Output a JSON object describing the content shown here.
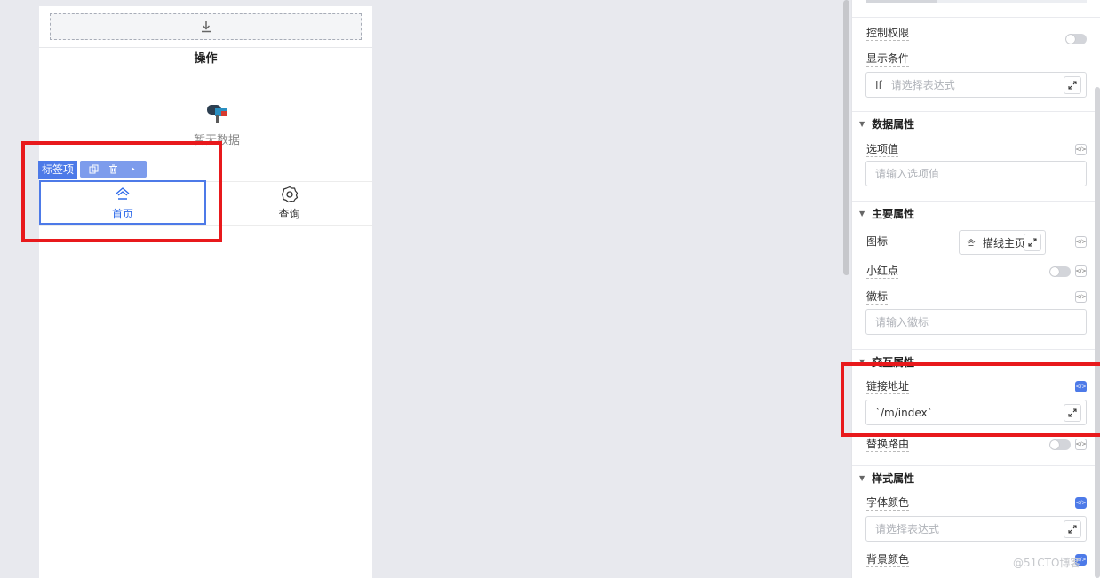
{
  "canvas": {
    "section_title": "操作",
    "empty_text": "暂无数据",
    "tabs": [
      {
        "label": "首页",
        "icon": "home-icon"
      },
      {
        "label": "查询",
        "icon": "gear-icon"
      }
    ],
    "selection": {
      "label": "标签项",
      "actions": [
        "copy-icon",
        "delete-icon",
        "more-arrow-icon"
      ]
    }
  },
  "panel": {
    "control_permission": "控制权限",
    "display_condition": "显示条件",
    "condition_input": {
      "prefix": "If",
      "placeholder": "请选择表达式"
    },
    "data_group": "数据属性",
    "option_value_label": "选项值",
    "option_value_placeholder": "请输入选项值",
    "main_group": "主要属性",
    "icon_label": "图标",
    "icon_value": "描线主页",
    "red_dot_label": "小红点",
    "badge_label": "徽标",
    "badge_placeholder": "请输入徽标",
    "interaction_group": "交互属性",
    "link_label": "链接地址",
    "link_value": "`/m/index`",
    "replace_route_label": "替换路由",
    "style_group": "样式属性",
    "font_color_label": "字体颜色",
    "font_color_placeholder": "请选择表达式",
    "bg_color_label": "背景颜色"
  },
  "watermark": "@51CTO博客",
  "colors": {
    "accent": "#4d7ae8",
    "highlight": "#e8191c"
  }
}
